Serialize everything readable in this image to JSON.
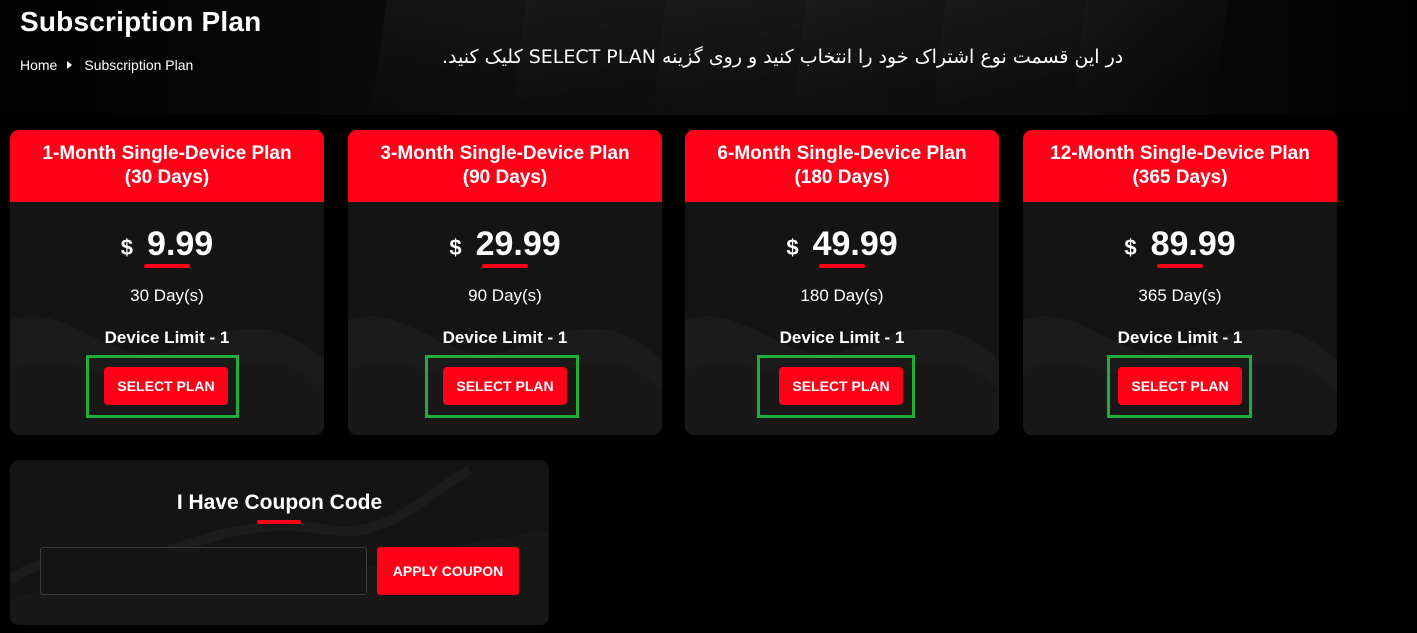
{
  "page": {
    "title": "Subscription Plan",
    "instruction": "در این قسمت نوع اشتراک خود را انتخاب کنید و روی گزینه SELECT PLAN کلیک کنید."
  },
  "breadcrumb": {
    "home": "Home",
    "current": "Subscription Plan"
  },
  "plans": [
    {
      "name_line1": "1-Month Single-Device Plan",
      "name_line2": "(30 Days)",
      "currency": "$",
      "price": "9.99",
      "duration": "30 Day(s)",
      "device_limit": "Device Limit - 1",
      "button": "SELECT PLAN"
    },
    {
      "name_line1": "3-Month Single-Device Plan",
      "name_line2": "(90 Days)",
      "currency": "$",
      "price": "29.99",
      "duration": "90 Day(s)",
      "device_limit": "Device Limit - 1",
      "button": "SELECT PLAN"
    },
    {
      "name_line1": "6-Month Single-Device Plan",
      "name_line2": "(180 Days)",
      "currency": "$",
      "price": "49.99",
      "duration": "180 Day(s)",
      "device_limit": "Device Limit - 1",
      "button": "SELECT PLAN"
    },
    {
      "name_line1": "12-Month Single-Device Plan",
      "name_line2": "(365 Days)",
      "currency": "$",
      "price": "89.99",
      "duration": "365 Day(s)",
      "device_limit": "Device Limit - 1",
      "button": "SELECT PLAN"
    }
  ],
  "coupon": {
    "title": "I Have Coupon Code",
    "input_value": "",
    "button": "APPLY COUPON"
  },
  "colors": {
    "accent": "#ff0019",
    "card_bg": "#141414",
    "highlight": "#1fae3a",
    "page_bg": "#000000"
  }
}
